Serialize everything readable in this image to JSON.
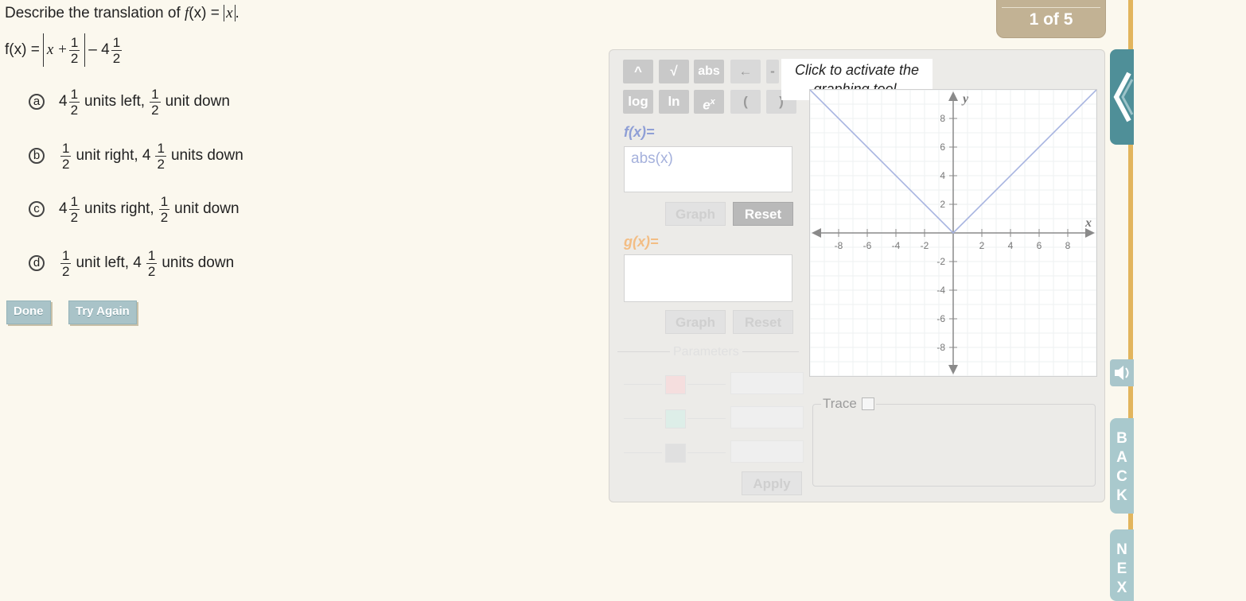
{
  "question": {
    "prompt_prefix": "Describe the translation of ",
    "prompt_func": "f",
    "prompt_mid": "(x) = ",
    "prompt_abs_var": "x",
    "prompt_end": ".",
    "function": {
      "lhs": "f(x) =",
      "inner": "x +",
      "frac_num": "1",
      "frac_den": "2",
      "minus": "– 4",
      "frac2_num": "1",
      "frac2_den": "2"
    }
  },
  "choices": [
    {
      "letter": "a",
      "whole1": "4",
      "num1": "1",
      "den1": "2",
      "text1": "units left,",
      "whole2": "",
      "num2": "1",
      "den2": "2",
      "text2": "unit down"
    },
    {
      "letter": "b",
      "whole1": "",
      "num1": "1",
      "den1": "2",
      "text1": "unit right, 4",
      "whole2": "",
      "num2": "1",
      "den2": "2",
      "text2": "units down"
    },
    {
      "letter": "c",
      "whole1": "4",
      "num1": "1",
      "den1": "2",
      "text1": "units right,",
      "whole2": "",
      "num2": "1",
      "den2": "2",
      "text2": "unit down"
    },
    {
      "letter": "d",
      "whole1": "",
      "num1": "1",
      "den1": "2",
      "text1": "unit left, 4",
      "whole2": "",
      "num2": "1",
      "den2": "2",
      "text2": "units down"
    }
  ],
  "buttons": {
    "done": "Done",
    "try_again": "Try Again"
  },
  "header": {
    "counter": "1 of 5"
  },
  "tool": {
    "keys_row1": [
      "^",
      "√",
      "abs",
      "←",
      "-"
    ],
    "keys_row2": [
      "log",
      "ln",
      "e",
      "(",
      ")"
    ],
    "key_ex_sup": "x",
    "tooltip": "Click to activate the graphing tool.",
    "f_label": "f(x)=",
    "f_value": "abs(x)",
    "g_label": "g(x)=",
    "graph_label": "Graph",
    "reset_label": "Reset",
    "params_label": "Parameters",
    "apply_label": "Apply",
    "trace_label": "Trace"
  },
  "colors": {
    "f_color": "#8f9fd6",
    "g_color": "#f3bd84",
    "plot_line": "#a7b4e0",
    "accent": "#4f8f98"
  },
  "rail": {
    "back": [
      "B",
      "A",
      "C",
      "K"
    ],
    "next": [
      "N",
      "E",
      "X"
    ]
  },
  "chart_data": {
    "type": "line",
    "series": [
      {
        "name": "f(x)=abs(x)",
        "x": [
          -10,
          0,
          10
        ],
        "y": [
          10,
          0,
          10
        ]
      }
    ],
    "xlabel": "x",
    "ylabel": "y",
    "xlim": [
      -10,
      10
    ],
    "ylim": [
      -10,
      10
    ],
    "xticks": [
      -8,
      -6,
      -4,
      -2,
      2,
      4,
      6,
      8
    ],
    "yticks": [
      8,
      6,
      4,
      2,
      -2,
      -4,
      -6,
      -8
    ],
    "grid": true
  }
}
